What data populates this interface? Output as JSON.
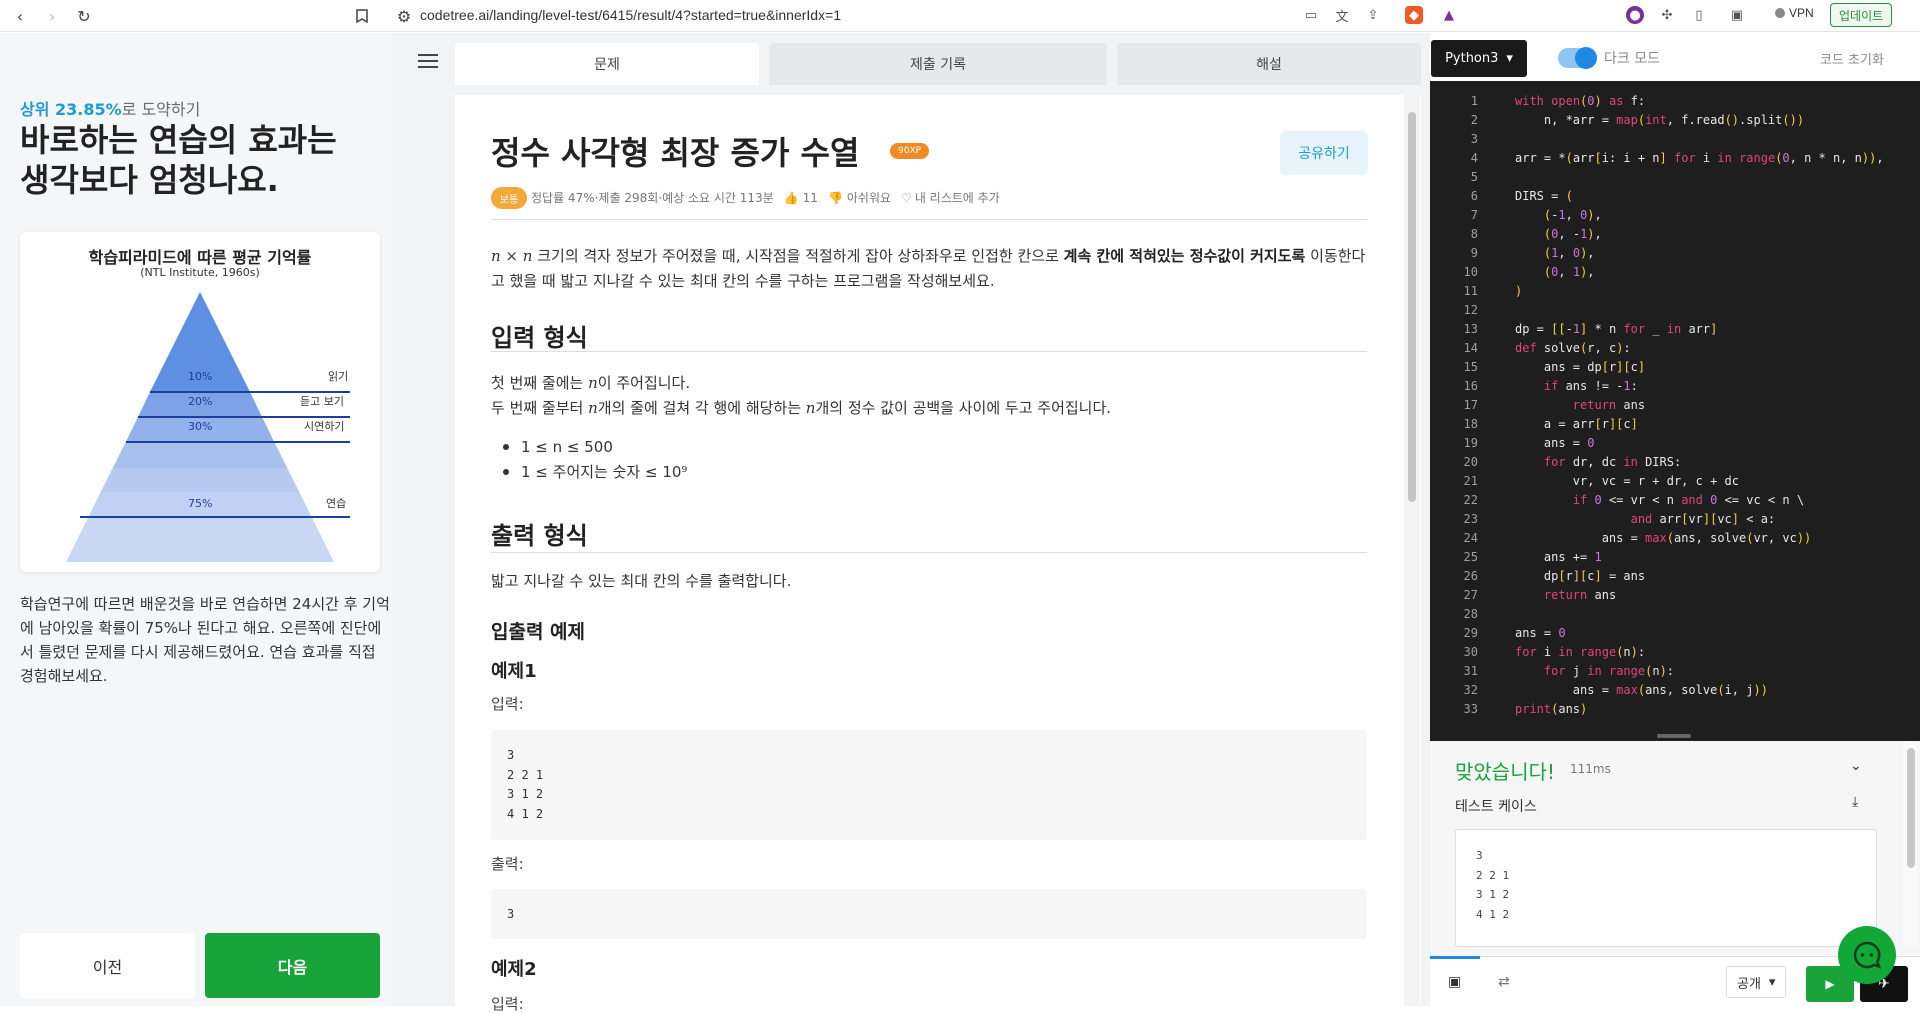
{
  "browser": {
    "url": "codetree.ai/landing/level-test/6415/result/4?started=true&innerIdx=1",
    "vpn_label": "VPN",
    "update_label": "업데이트"
  },
  "left": {
    "rank_highlight": "상위 23.85%",
    "rank_suffix": "로 도약하기",
    "headline_line1": "바로하는 연습의 효과는",
    "headline_line2": "생각보다 엄청나요.",
    "pyramid_title": "학습피라미드에 따른 평균 기억률",
    "pyramid_subtitle": "(NTL Institute, 1960s)",
    "pyramid_levels": [
      {
        "percent": "10%",
        "label": "읽기"
      },
      {
        "percent": "20%",
        "label": "듣고 보기"
      },
      {
        "percent": "30%",
        "label": "시연하기"
      },
      {
        "percent": "75%",
        "label": "연습"
      }
    ],
    "description": "학습연구에 따르면 배운것을 바로 연습하면 24시간 후 기억에 남아있을 확률이 75%나 된다고 해요. 오른쪽에 진단에서 틀렸던 문제를 다시 제공해드렸어요. 연습 효과를 직접 경험해보세요.",
    "prev_label": "이전",
    "next_label": "다음"
  },
  "tabs": [
    "문제",
    "제출 기록",
    "해설"
  ],
  "problem": {
    "title": "정수 사각형 최장 증가 수열",
    "xp": "90XP",
    "share_label": "공유하기",
    "level": "보통",
    "meta": "정답률 47%·제출 298회·예상 소요 시간 113분",
    "likes": "11",
    "dislike_label": "아쉬워요",
    "add_list_label": "내 리스트에 추가",
    "desc_prefix": "크기의 격자 정보가 주어졌을 때, 시작점을 적절하게 잡아 상하좌우로 인접한 칸으로 ",
    "desc_bold": "계속 칸에 적혀있는 정수값이 커지도록",
    "desc_suffix": " 이동한다고 했을 때 밟고 지나갈 수 있는 최대 칸의 수를 구하는 프로그램을 작성해보세요.",
    "input_heading": "입력 형식",
    "input_line1": "이 주어집니다.",
    "input_line1_prefix": "첫 번째 줄에는 ",
    "input_line2_prefix": "두 번째 줄부터 ",
    "input_line2_mid": "개의 줄에 걸쳐 각 행에 해당하는 ",
    "input_line2_suffix": "개의 정수 값이 공백을 사이에 두고 주어집니다.",
    "constraint1": "1 ≤ n ≤ 500",
    "constraint2": "1 ≤ 주어지는 숫자 ≤ 10⁹",
    "output_heading": "출력 형식",
    "output_desc": "밟고 지나갈 수 있는 최대 칸의 수를 출력합니다.",
    "io_heading": "입출력 예제",
    "example1": "예제1",
    "input_label": "입력:",
    "example1_input": "3\n2 2 1\n3 1 2\n4 1 2",
    "output_label": "출력:",
    "example1_output": "3",
    "example2": "예제2",
    "input_label2": "입력:"
  },
  "editor": {
    "language": "Python3",
    "dark_mode_label": "다크 모드",
    "reset_label": "코드 초기화",
    "line_count": 33
  },
  "result": {
    "status": "맞았습니다!",
    "time": "111ms",
    "testcase_label": "테스트 케이스",
    "testcase_input": "3\n2 2 1\n3 1 2\n4 1 2",
    "visibility": "공개"
  }
}
